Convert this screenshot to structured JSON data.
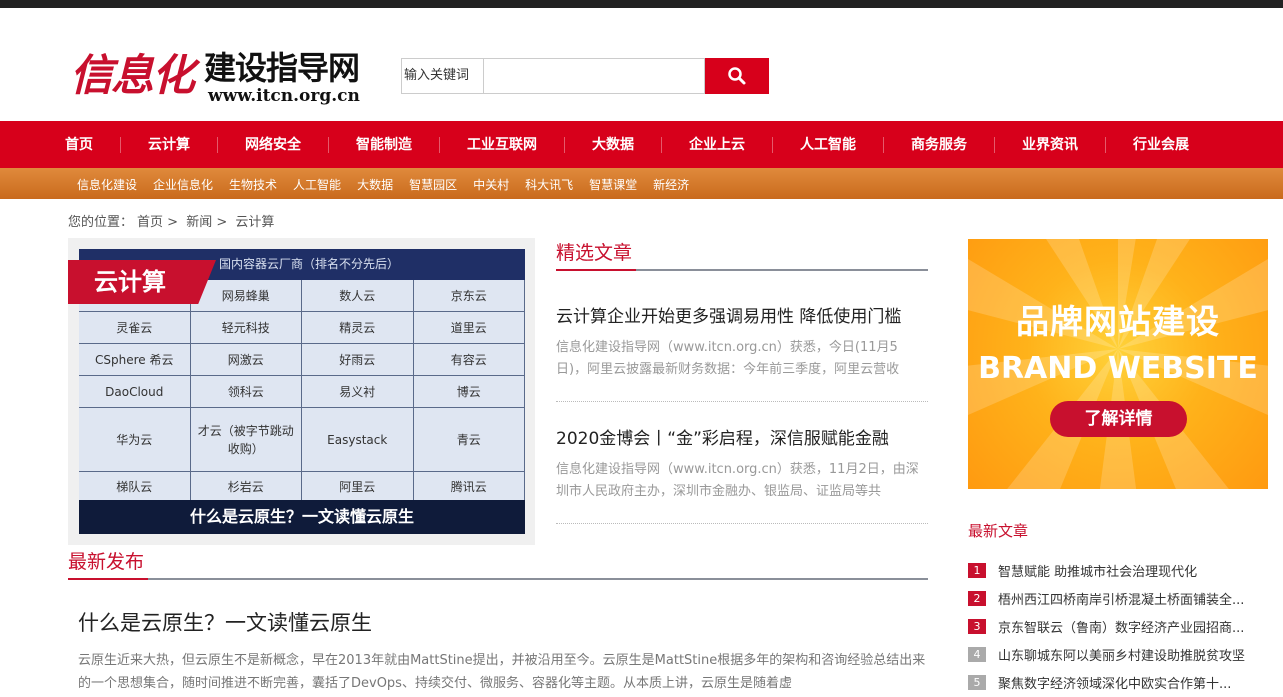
{
  "logo": {
    "red": "信息化",
    "black": "建设指导网",
    "url": "www.itcn.org.cn"
  },
  "search": {
    "label": "输入关键词",
    "placeholder": ""
  },
  "nav": [
    "首页",
    "云计算",
    "网络安全",
    "智能制造",
    "工业互联网",
    "大数据",
    "企业上云",
    "人工智能",
    "商务服务",
    "业界资讯",
    "行业会展"
  ],
  "subnav": [
    "信息化建设",
    "企业信息化",
    "生物技术",
    "人工智能",
    "大数据",
    "智慧园区",
    "中关村",
    "科大讯飞",
    "智慧课堂",
    "新经济"
  ],
  "breadcrumb": {
    "prefix": "您的位置：",
    "home": "首页",
    "sep": ">",
    "news": "新闻",
    "current": "云计算"
  },
  "feature": {
    "ribbon": "云计算",
    "table_head": "国内容器云厂商（排名不分先后）",
    "rows": [
      [
        "",
        "网易蜂巢",
        "数人云",
        "京东云"
      ],
      [
        "灵雀云",
        "轻元科技",
        "精灵云",
        "道里云"
      ],
      [
        "CSphere 希云",
        "网激云",
        "好雨云",
        "有容云"
      ],
      [
        "DaoCloud",
        "领科云",
        "易义衬",
        "博云"
      ],
      [
        "华为云",
        "才云（被字节跳动收购）",
        "Easystack",
        "青云"
      ],
      [
        "梯队云",
        "杉岩云",
        "阿里云",
        "腾讯云"
      ]
    ],
    "caption": "什么是云原生？一文读懂云原生"
  },
  "featured": {
    "title": "精选文章",
    "articles": [
      {
        "title": "云计算企业开始更多强调易用性 降低使用门槛",
        "summary": "信息化建设指导网（www.itcn.org.cn）获悉，今日(11月5日)，阿里云披露最新财务数据：今年前三季度，阿里云营收"
      },
      {
        "title": "2020金博会丨“金”彩启程，深信服赋能金融",
        "summary": "信息化建设指导网（www.itcn.org.cn）获悉，11月2日，由深圳市人民政府主办，深圳市金融办、银监局、证监局等共"
      }
    ]
  },
  "latest_release": {
    "title": "最新发布",
    "article": {
      "title": "什么是云原生？一文读懂云原生",
      "summary": "云原生近来大热，但云原生不是新概念，早在2013年就由MattStine提出，并被沿用至今。云原生是MattStine根据多年的架构和咨询经验总结出来的一个思想集合，随时间推进不断完善，囊括了DevOps、持续交付、微服务、容器化等主题。从本质上讲，云原生是随着虚"
    }
  },
  "ad": {
    "title": "品牌网站建设",
    "subtitle": "BRAND WEBSITE",
    "button": "了解详情"
  },
  "latest": {
    "title": "最新文章",
    "items": [
      {
        "num": "1",
        "text": "智慧赋能 助推城市社会治理现代化"
      },
      {
        "num": "2",
        "text": "梧州西江四桥南岸引桥混凝土桥面铺装全..."
      },
      {
        "num": "3",
        "text": "京东智联云（鲁南）数字经济产业园招商..."
      },
      {
        "num": "4",
        "text": "山东聊城东阿以美丽乡村建设助推脱贫攻坚"
      },
      {
        "num": "5",
        "text": "聚焦数字经济领域深化中欧实合作第十..."
      }
    ]
  },
  "colors": {
    "brand_red": "#d7001b",
    "orange": "#d97a2b",
    "title_red": "#c8102e"
  }
}
